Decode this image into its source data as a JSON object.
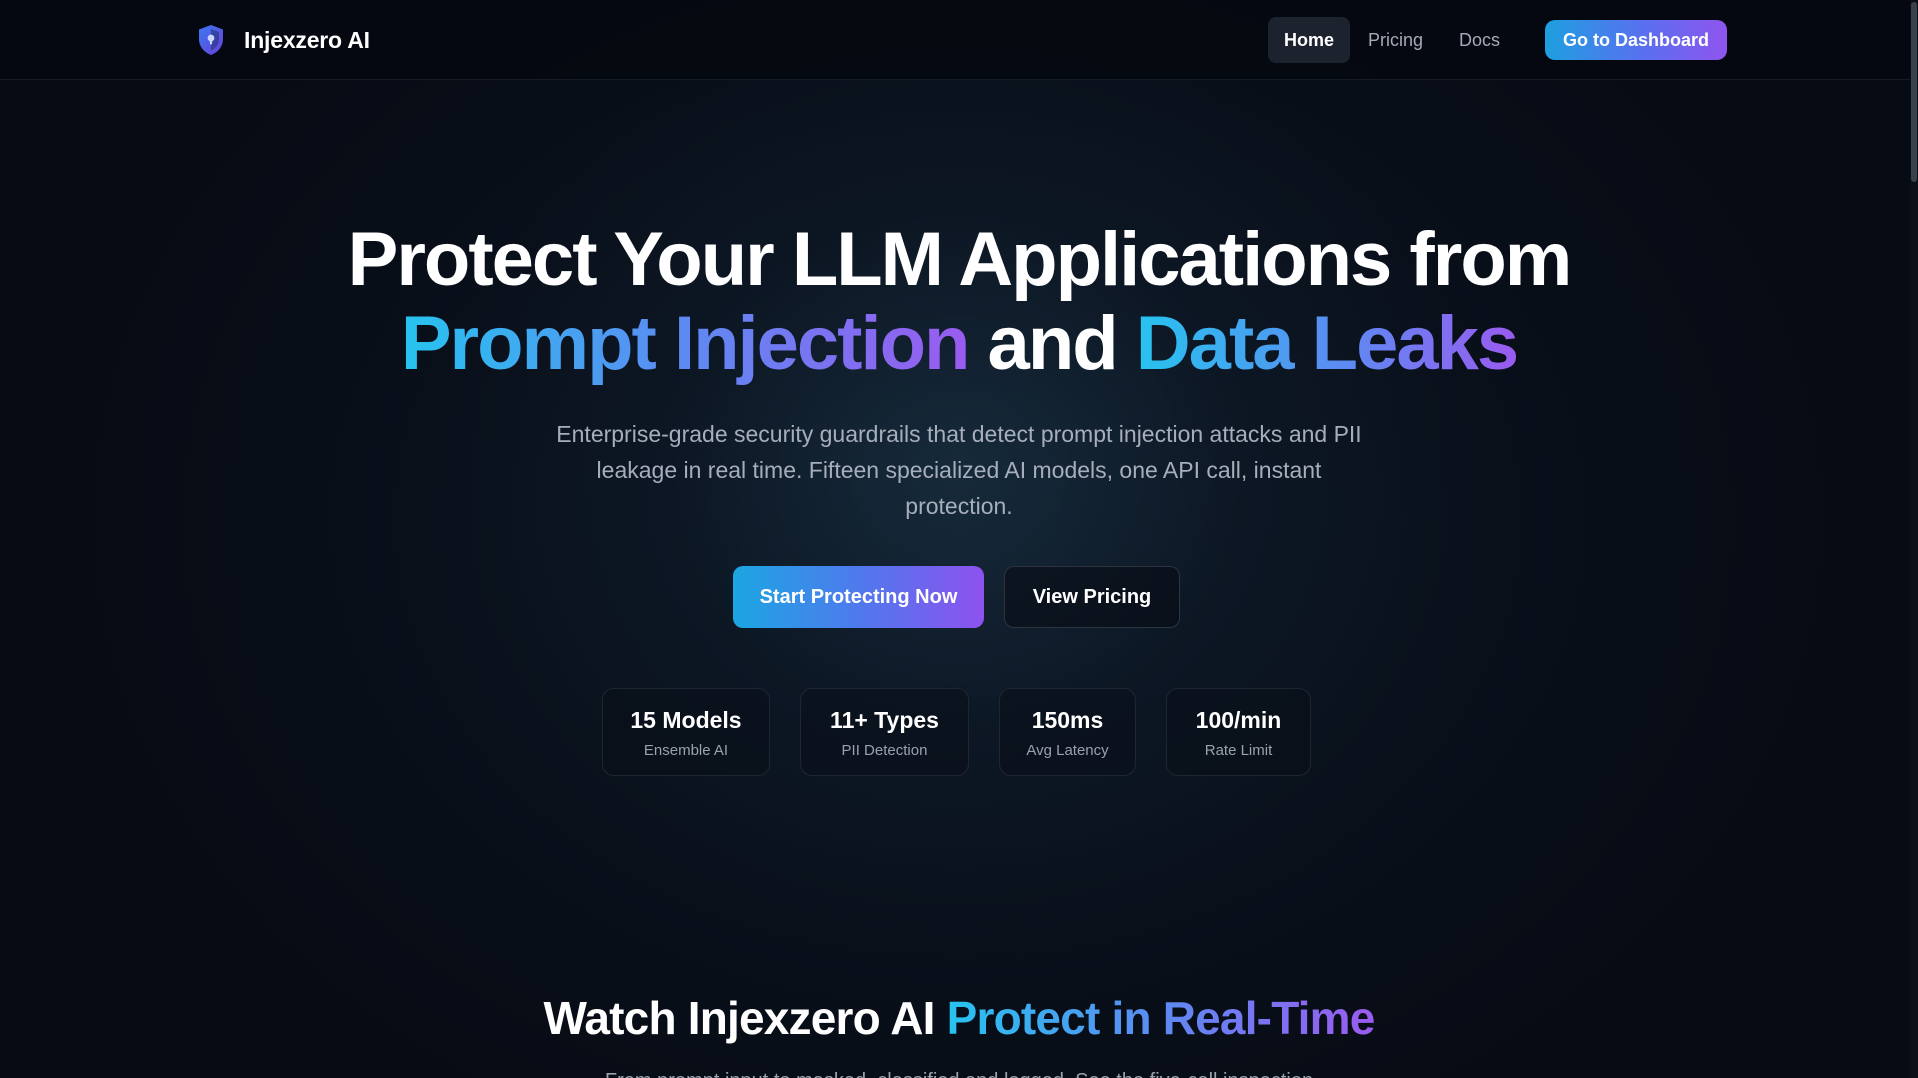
{
  "nav": {
    "brand": "Injexzero AI",
    "brand_icon": "shield-icon",
    "links": [
      "Home",
      "Pricing",
      "Docs"
    ],
    "active": "Home",
    "dashboard_label": "Go to Dashboard"
  },
  "hero": {
    "title_line1": "Protect Your LLM Applications from",
    "title_highlight1": "Prompt Injection",
    "title_and": " and ",
    "title_highlight2": "Data Leaks",
    "subtitle": "Enterprise-grade security guardrails that detect prompt injection attacks and PII leakage in real time. Fifteen specialized AI models, one API call, instant protection.",
    "cta_primary": "Start Protecting Now",
    "cta_secondary": "View Pricing"
  },
  "stats": [
    {
      "value": "15 Models",
      "label": "Ensemble AI"
    },
    {
      "value": "11+ Types",
      "label": "PII Detection"
    },
    {
      "value": "150ms",
      "label": "Avg Latency"
    },
    {
      "value": "100/min",
      "label": "Rate Limit"
    }
  ],
  "section": {
    "title_plain": "Watch Injexzero AI ",
    "title_highlight": "Protect in Real-Time",
    "subtitle": "From prompt input to masked, classified and logged. See the five-call inspection"
  },
  "colors": {
    "accent_blue": "#27c3ef",
    "accent_purple": "#9a5bf0",
    "background": "#070b14"
  }
}
